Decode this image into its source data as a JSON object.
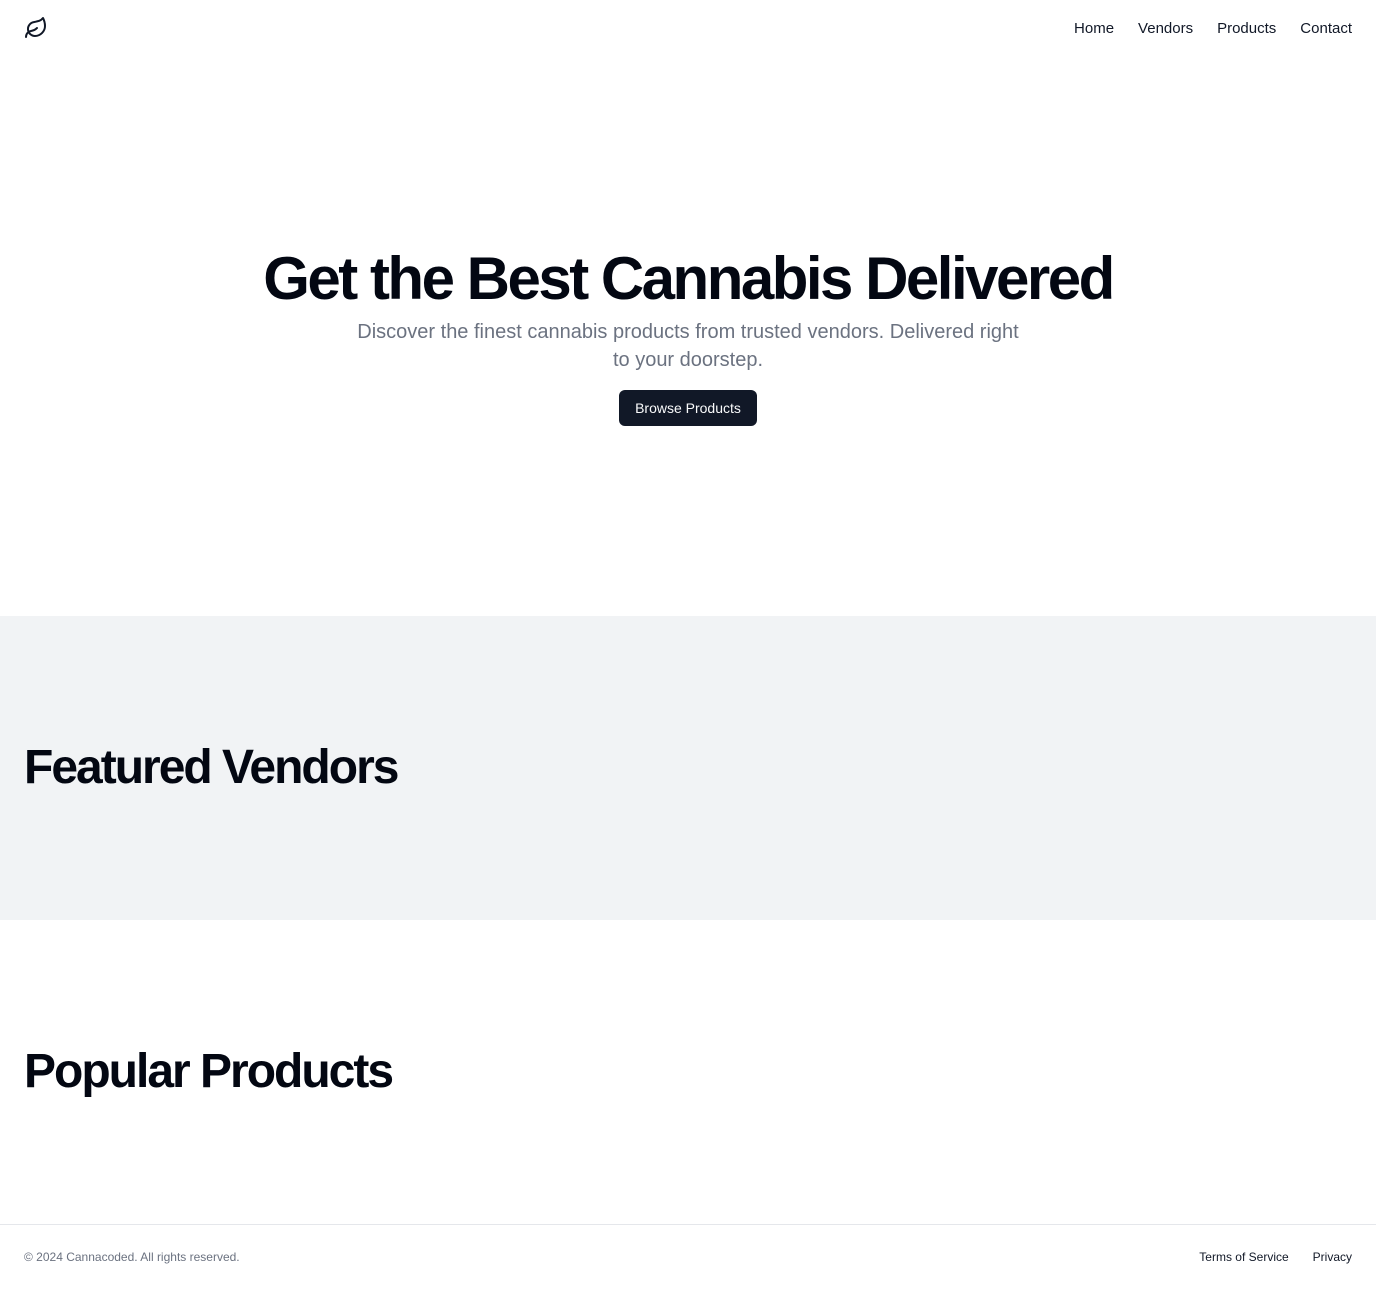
{
  "header": {
    "logo_icon": "leaf-icon",
    "nav": [
      {
        "label": "Home"
      },
      {
        "label": "Vendors"
      },
      {
        "label": "Products"
      },
      {
        "label": "Contact"
      }
    ]
  },
  "hero": {
    "title": "Get the Best Cannabis Delivered",
    "subtitle": "Discover the finest cannabis products from trusted vendors. Delivered right to your doorstep.",
    "button_label": "Browse Products"
  },
  "vendors_section": {
    "title": "Featured Vendors",
    "background": "#f1f3f5"
  },
  "products_section": {
    "title": "Popular Products"
  },
  "footer": {
    "copyright": "© 2024 Cannacoded. All rights reserved.",
    "links": [
      {
        "label": "Terms of Service"
      },
      {
        "label": "Privacy"
      }
    ]
  },
  "colors": {
    "primary_button": "#111827",
    "muted_text": "#6b7280"
  }
}
